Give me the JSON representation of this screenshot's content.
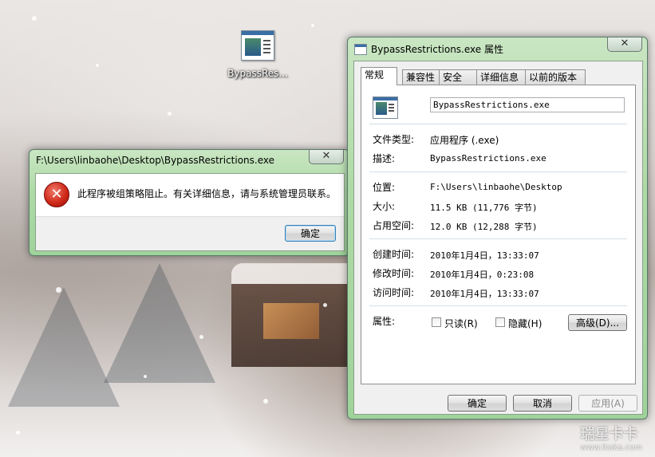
{
  "desktop": {
    "icon_label": "BypassRes..."
  },
  "error_dialog": {
    "title": "F:\\Users\\linbaohe\\Desktop\\BypassRestrictions.exe",
    "close_glyph": "✕",
    "icon": "error-x-icon",
    "message": "此程序被组策略阻止。有关详细信息，请与系统管理员联系。",
    "ok_label": "确定"
  },
  "properties_window": {
    "title": "BypassRestrictions.exe 属性",
    "close_glyph": "✕",
    "tabs": [
      {
        "label": "常规",
        "active": true
      },
      {
        "label": "兼容性",
        "active": false
      },
      {
        "label": "安全",
        "active": false
      },
      {
        "label": "详细信息",
        "active": false
      },
      {
        "label": "以前的版本",
        "active": false
      }
    ],
    "file_name": "BypassRestrictions.exe",
    "fields": {
      "type_label": "文件类型:",
      "type_value": "应用程序 (.exe)",
      "desc_label": "描述:",
      "desc_value": "BypassRestrictions.exe",
      "location_label": "位置:",
      "location_value": "F:\\Users\\linbaohe\\Desktop",
      "size_label": "大小:",
      "size_value": "11.5 KB (11,776 字节)",
      "disk_label": "占用空间:",
      "disk_value": "12.0 KB (12,288 字节)",
      "created_label": "创建时间:",
      "created_value": "2010年1月4日，13:33:07",
      "modified_label": "修改时间:",
      "modified_value": "2010年1月4日，0:23:08",
      "accessed_label": "访问时间:",
      "accessed_value": "2010年1月4日，13:33:07",
      "attr_label": "属性:",
      "readonly_label": "只读(R)",
      "hidden_label": "隐藏(H)",
      "advanced_label": "高级(D)..."
    },
    "buttons": {
      "ok": "确定",
      "cancel": "取消",
      "apply": "应用(A)"
    }
  },
  "watermark": {
    "main": "瑞星卡卡",
    "url": "www.ikaka.com"
  }
}
